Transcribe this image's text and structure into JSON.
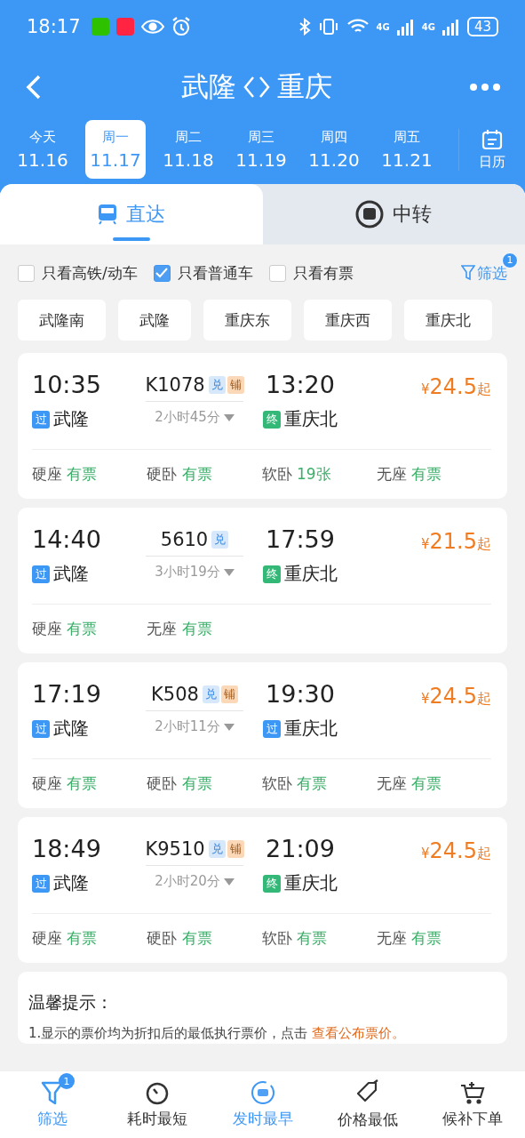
{
  "status_bar": {
    "time": "18:17",
    "network_labels": [
      "4G",
      "4G"
    ],
    "battery": "43"
  },
  "header": {
    "from": "武隆",
    "to": "重庆"
  },
  "dates": [
    {
      "weekday": "今天",
      "date": "11.16",
      "selected": false
    },
    {
      "weekday": "周一",
      "date": "11.17",
      "selected": true
    },
    {
      "weekday": "周二",
      "date": "11.18",
      "selected": false
    },
    {
      "weekday": "周三",
      "date": "11.19",
      "selected": false
    },
    {
      "weekday": "周四",
      "date": "11.20",
      "selected": false
    },
    {
      "weekday": "周五",
      "date": "11.21",
      "selected": false
    }
  ],
  "calendar_label": "日历",
  "tabs": [
    {
      "label": "直达",
      "kind": "direct",
      "selected": true
    },
    {
      "label": "中转",
      "kind": "transfer",
      "selected": false
    }
  ],
  "filters": [
    {
      "label": "只看高铁/动车",
      "checked": false
    },
    {
      "label": "只看普通车",
      "checked": true
    },
    {
      "label": "只看有票",
      "checked": false
    }
  ],
  "filter_button": {
    "label": "筛选",
    "badge": "1"
  },
  "stations": [
    "武隆南",
    "武隆",
    "重庆东",
    "重庆西",
    "重庆北"
  ],
  "trains": [
    {
      "depart": "10:35",
      "train_no": "K1078",
      "tags": [
        {
          "label": "兑",
          "kind": "exchange"
        },
        {
          "label": "铺",
          "kind": "berth"
        }
      ],
      "arrive": "13:20",
      "duration": "2小时45分",
      "currency": "¥",
      "price": "24.5",
      "price_suffix": "起",
      "from": {
        "tag": "过",
        "kind": "pass",
        "name": "武隆"
      },
      "to": {
        "tag": "终",
        "kind": "terminal",
        "name": "重庆北"
      },
      "seats": [
        {
          "type": "硬座",
          "availability": "有票"
        },
        {
          "type": "硬卧",
          "availability": "有票"
        },
        {
          "type": "软卧",
          "availability": "19张"
        },
        {
          "type": "无座",
          "availability": "有票"
        }
      ]
    },
    {
      "depart": "14:40",
      "train_no": "5610",
      "tags": [
        {
          "label": "兑",
          "kind": "exchange"
        }
      ],
      "arrive": "17:59",
      "duration": "3小时19分",
      "currency": "¥",
      "price": "21.5",
      "price_suffix": "起",
      "from": {
        "tag": "过",
        "kind": "pass",
        "name": "武隆"
      },
      "to": {
        "tag": "终",
        "kind": "terminal",
        "name": "重庆北"
      },
      "seats": [
        {
          "type": "硬座",
          "availability": "有票"
        },
        {
          "type": "无座",
          "availability": "有票"
        }
      ]
    },
    {
      "depart": "17:19",
      "train_no": "K508",
      "tags": [
        {
          "label": "兑",
          "kind": "exchange"
        },
        {
          "label": "铺",
          "kind": "berth"
        }
      ],
      "arrive": "19:30",
      "duration": "2小时11分",
      "currency": "¥",
      "price": "24.5",
      "price_suffix": "起",
      "from": {
        "tag": "过",
        "kind": "pass",
        "name": "武隆"
      },
      "to": {
        "tag": "过",
        "kind": "pass",
        "name": "重庆北"
      },
      "seats": [
        {
          "type": "硬座",
          "availability": "有票"
        },
        {
          "type": "硬卧",
          "availability": "有票"
        },
        {
          "type": "软卧",
          "availability": "有票"
        },
        {
          "type": "无座",
          "availability": "有票"
        }
      ]
    },
    {
      "depart": "18:49",
      "train_no": "K9510",
      "tags": [
        {
          "label": "兑",
          "kind": "exchange"
        },
        {
          "label": "铺",
          "kind": "berth"
        }
      ],
      "arrive": "21:09",
      "duration": "2小时20分",
      "currency": "¥",
      "price": "24.5",
      "price_suffix": "起",
      "from": {
        "tag": "过",
        "kind": "pass",
        "name": "武隆"
      },
      "to": {
        "tag": "终",
        "kind": "terminal",
        "name": "重庆北"
      },
      "seats": [
        {
          "type": "硬座",
          "availability": "有票"
        },
        {
          "type": "硬卧",
          "availability": "有票"
        },
        {
          "type": "软卧",
          "availability": "有票"
        },
        {
          "type": "无座",
          "availability": "有票"
        }
      ]
    }
  ],
  "tips": {
    "title": "温馨提示：",
    "text": "1.显示的票价均为折扣后的最低执行票价，点击",
    "link": "查看公布票价。"
  },
  "bottom_nav": [
    {
      "label": "筛选",
      "kind": "filter",
      "selected": true,
      "badge": "1"
    },
    {
      "label": "耗时最短",
      "kind": "duration",
      "selected": false
    },
    {
      "label": "发时最早",
      "kind": "earliest",
      "selected": true
    },
    {
      "label": "价格最低",
      "kind": "price",
      "selected": false
    },
    {
      "label": "候补下单",
      "kind": "waitlist",
      "selected": false
    }
  ]
}
